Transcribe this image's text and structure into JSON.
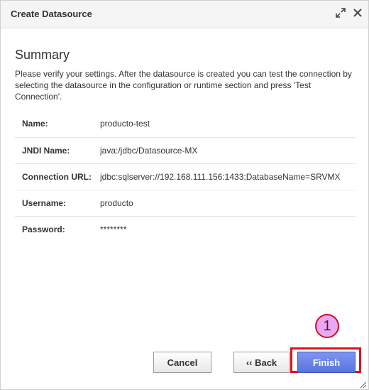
{
  "dialog": {
    "title": "Create Datasource",
    "maximize_icon": "expand-arrows-icon",
    "close_icon": "close-x-icon"
  },
  "summary": {
    "heading": "Summary",
    "description": "Please verify your settings. After the datasource is created you can test the connection by selecting the datasource in the configuration or runtime section and press 'Test Connection'.",
    "rows": [
      {
        "label": "Name:",
        "value": "producto-test"
      },
      {
        "label": "JNDI Name:",
        "value": "java:/jdbc/Datasource-MX"
      },
      {
        "label": "Connection URL:",
        "value": "jdbc:sqlserver://192.168.111.156:1433;DatabaseName=SRVMX"
      },
      {
        "label": "Username:",
        "value": "producto"
      },
      {
        "label": "Password:",
        "value": "********"
      }
    ]
  },
  "annotation": {
    "step_number": "1",
    "colors": {
      "circle_fill": "#e9a8f3",
      "circle_border": "#d01020",
      "highlight_border": "#e0101a"
    }
  },
  "buttons": {
    "cancel": "Cancel",
    "back": "‹‹ Back",
    "finish": "Finish"
  },
  "colors": {
    "finish_button": "#6a84e8",
    "titlebar_bg": "#f5f5f5"
  }
}
